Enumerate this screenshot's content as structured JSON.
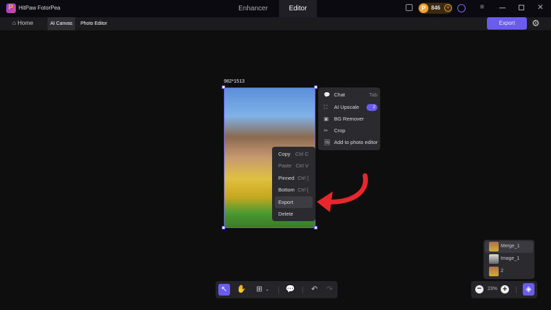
{
  "app": {
    "title": "HitPaw FotorPea",
    "tabs": [
      "Enhancer",
      "Editor"
    ],
    "active_tab": "Editor",
    "credits": "846"
  },
  "toolbar": {
    "home": "Home",
    "ai_canvas": "AI Canvas",
    "photo_editor": "Photo Editor",
    "export": "Export"
  },
  "canvas": {
    "size_label": "982*1513"
  },
  "ai_menu": [
    {
      "label": "Chat",
      "shortcut": "Tab"
    },
    {
      "label": "AI Upscale",
      "badge": "2"
    },
    {
      "label": "BG Remover"
    },
    {
      "label": "Crop"
    },
    {
      "label": "Add to photo editor"
    }
  ],
  "context_menu": [
    {
      "label": "Copy",
      "shortcut": "Ctrl C"
    },
    {
      "label": "Paste",
      "shortcut": "Ctrl V"
    },
    {
      "label": "Pinned",
      "shortcut": "Ctrl ]"
    },
    {
      "label": "Bottom",
      "shortcut": "Ctrl ["
    },
    {
      "label": "Export",
      "shortcut": ""
    },
    {
      "label": "Delete",
      "shortcut": ""
    }
  ],
  "layers": [
    "Merge_1",
    "Image_1",
    "2"
  ],
  "zoom": {
    "level": "23%"
  },
  "colors": {
    "accent": "#6b5cf0",
    "arrow": "#e8272c"
  }
}
